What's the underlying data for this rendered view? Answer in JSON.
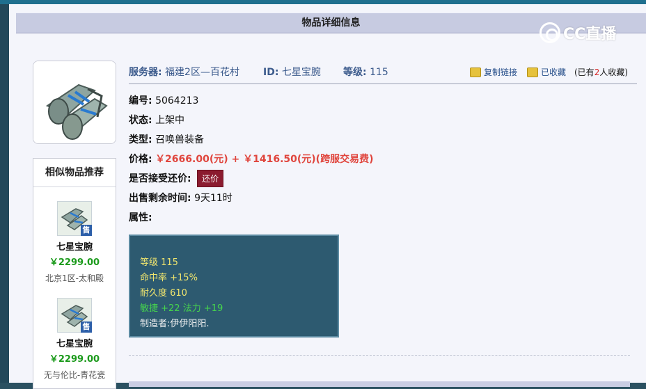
{
  "panel": {
    "title": "物品详细信息"
  },
  "watermark": {
    "text": "CC直播"
  },
  "item": {
    "server_label": "服务器:",
    "server_value": "福建2区—百花村",
    "id_label": "ID:",
    "id_value": "七星宝腕",
    "level_label": "等级:",
    "level_value": "115",
    "copy_link": "复制链接",
    "favorited": "已收藏",
    "fav_prefix": "(已有",
    "fav_count": "2",
    "fav_suffix": "人收藏)",
    "code_label": "编号:",
    "code_value": "5064213",
    "status_label": "状态:",
    "status_value": "上架中",
    "type_label": "类型:",
    "type_value": "召唤兽装备",
    "price_label": "价格:",
    "price_value": "￥2666.00(元)  +  ￥1416.50(元)(跨服交易费)",
    "bargain_label": "是否接受还价:",
    "bargain_button": "还价",
    "remain_label": "出售剩余时间:",
    "remain_value": "9天11时",
    "attr_label": "属性:"
  },
  "attributes": {
    "line1": "等级 115",
    "line2": "命中率 +15%",
    "line3": "耐久度 610",
    "line4": "敏捷 +22 法力 +19",
    "line5": "制造者:伊伊阳阳."
  },
  "similar": {
    "title": "相似物品推荐",
    "sale_badge": "售",
    "items": [
      {
        "name": "七星宝腕",
        "price": "￥2299.00",
        "server": "北京1区-太和殿"
      },
      {
        "name": "七星宝腕",
        "price": "￥2299.00",
        "server": "无与伦比-青花瓷"
      }
    ]
  },
  "icons": {
    "copy": "copy-link-icon",
    "favorite": "favorite-icon",
    "item": "bracer-item-icon"
  },
  "colors": {
    "accent_blue": "#3b5a8c",
    "price_red": "#e0453d",
    "price_green": "#1b9a1b",
    "button": "#8b1b2f"
  }
}
